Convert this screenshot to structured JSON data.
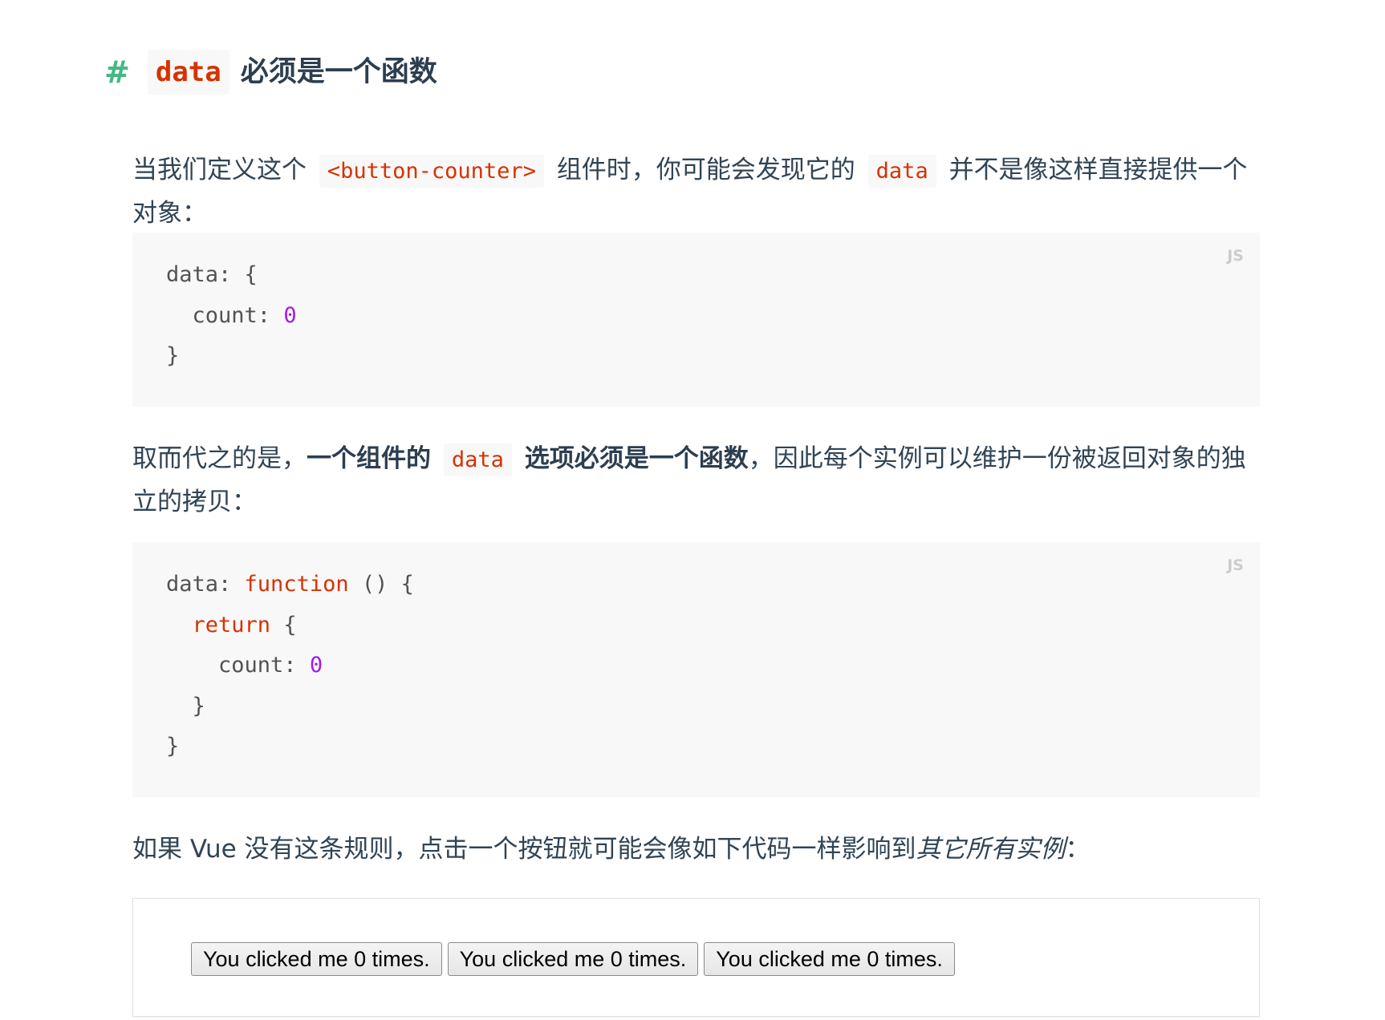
{
  "heading": {
    "hash": "#",
    "code": "data",
    "text": "必须是一个函数"
  },
  "para1": {
    "t1": "当我们定义这个",
    "code1": "<button-counter>",
    "t2": "组件时，你可能会发现它的",
    "code2": "data",
    "t3": "并不是像这样直接提供一个对象："
  },
  "code1": {
    "lang": "JS",
    "l1_a": "data: {",
    "l2_a": "  count: ",
    "l2_num": "0",
    "l3_a": "}"
  },
  "para2": {
    "t1": "取而代之的是，",
    "strong1": "一个组件的",
    "code1": "data",
    "strong2": "选项必须是一个函数",
    "t2": "，因此每个实例可以维护一份被返回对象的独立的拷贝："
  },
  "code2": {
    "lang": "JS",
    "l1_a": "data: ",
    "l1_kw": "function",
    "l1_b": " () {",
    "l2_a": "  ",
    "l2_kw": "return",
    "l2_b": " {",
    "l3_a": "    count: ",
    "l3_num": "0",
    "l4_a": "  }",
    "l5_a": "}"
  },
  "para3": {
    "t1": "如果 Vue 没有这条规则，点击一个按钮就可能会像如下代码一样影响到",
    "em": "其它所有实例",
    "t2": "："
  },
  "demo": {
    "buttons": [
      "You clicked me 0 times.",
      "You clicked me 0 times.",
      "You clicked me 0 times."
    ]
  },
  "colors": {
    "accent_hash": "#42b983",
    "code_text": "#d63200",
    "code_bg": "#f8f8f8",
    "number": "#a31be8",
    "body_text": "#304455"
  }
}
